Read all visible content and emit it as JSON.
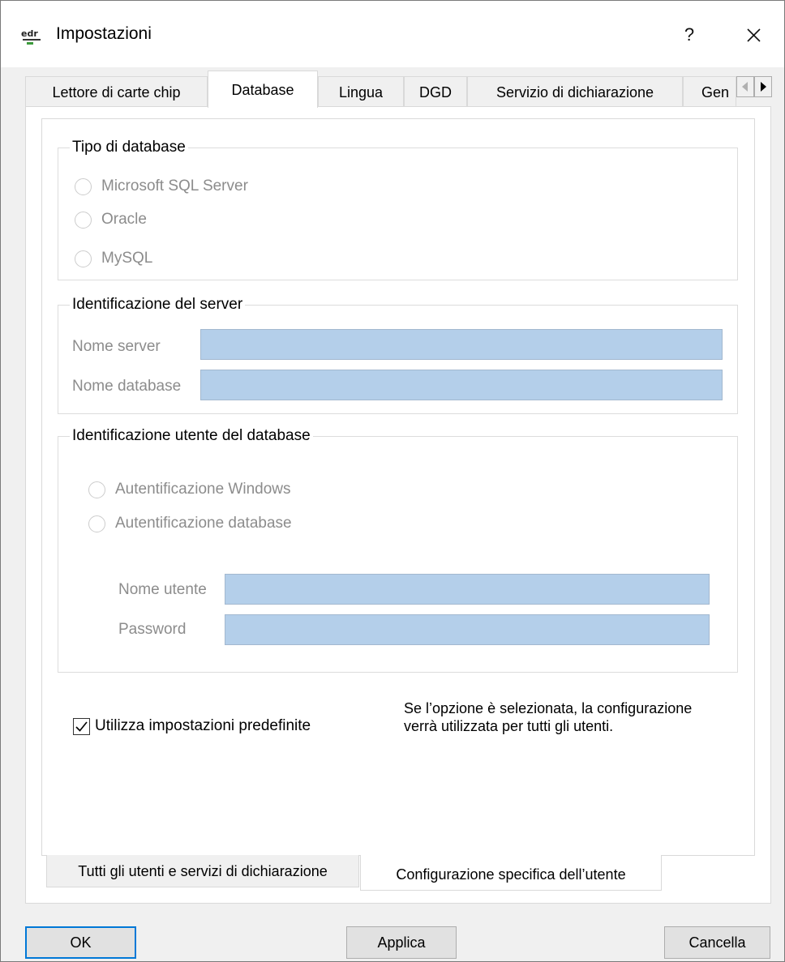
{
  "window": {
    "title": "Impostazioni",
    "help_label": "?"
  },
  "tabs": [
    {
      "label": "Lettore di carte chip",
      "active": false
    },
    {
      "label": "Database",
      "active": true
    },
    {
      "label": "Lingua",
      "active": false
    },
    {
      "label": "DGD",
      "active": false
    },
    {
      "label": "Servizio di dichiarazione",
      "active": false
    },
    {
      "label": "Gen",
      "active": false
    }
  ],
  "database_type": {
    "title": "Tipo di database",
    "options": [
      "Microsoft SQL Server",
      "Oracle",
      "MySQL"
    ]
  },
  "server_identification": {
    "title": "Identificazione del server",
    "server_name_label": "Nome server",
    "server_name_value": "",
    "database_name_label": "Nome database",
    "database_name_value": ""
  },
  "user_identification": {
    "title": "Identificazione utente del database",
    "options": [
      "Autentificazione Windows",
      "Autentificazione database"
    ],
    "username_label": "Nome utente",
    "username_value": "",
    "password_label": "Password",
    "password_value": ""
  },
  "defaults": {
    "checkbox_label": "Utilizza impostazioni predefinite",
    "checked": true,
    "note": "Se l’opzione è selezionata, la configurazione verrà utilizzata per tutti gli utenti."
  },
  "bottom_tabs": [
    {
      "label": "Tutti gli utenti e servizi di dichiarazione",
      "active": false
    },
    {
      "label": "Configurazione specifica dell’utente",
      "active": true
    }
  ],
  "buttons": {
    "ok": "OK",
    "apply": "Applica",
    "cancel": "Cancella"
  },
  "colors": {
    "field_fill": "#b4cfea",
    "default_button_border": "#0078d7",
    "disabled_text": "#8c8c8c"
  }
}
